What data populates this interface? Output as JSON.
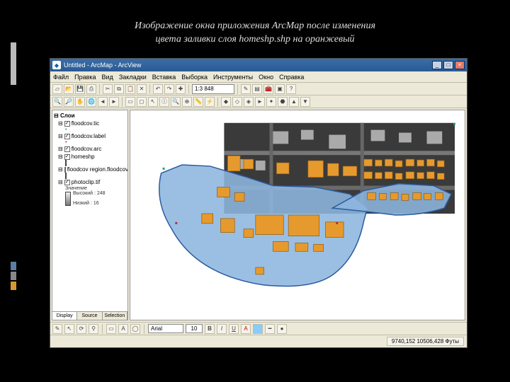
{
  "slide_caption_line1": "Изображение окна приложения ArcMap после изменения",
  "slide_caption_line2": "цвета заливки слоя homeshp.shp на оранжевый",
  "titlebar": {
    "text": "Untitled - ArcMap - ArcView"
  },
  "window_buttons": {
    "min": "_",
    "max": "□",
    "close": "×"
  },
  "menus": [
    "Файл",
    "Правка",
    "Вид",
    "Закладки",
    "Вставка",
    "Выборка",
    "Инструменты",
    "Окно",
    "Справка"
  ],
  "scale": "1:3 848",
  "toc": {
    "root": "Слои",
    "layers": [
      {
        "name": "floodcov.tic",
        "checked": true,
        "sym": "dot"
      },
      {
        "name": "floodcov.label",
        "checked": true,
        "sym": "dot2"
      },
      {
        "name": "floodcov.arc",
        "checked": true,
        "sym": "line"
      },
      {
        "name": "homeshp",
        "checked": true,
        "sym": "orange"
      },
      {
        "name": "floodcov region.floodcov",
        "checked": false,
        "sym": "blue"
      },
      {
        "name": "photoclip.tif",
        "checked": true,
        "sym": "gray"
      }
    ],
    "raster_header": "Значение",
    "raster_high": "Высокий : 248",
    "raster_low": "Низкий : 16",
    "tabs": [
      "Display",
      "Source",
      "Selection"
    ]
  },
  "bottom": {
    "font": "Arial",
    "size": "10"
  },
  "status": {
    "coords": "9740,152 10506,428 Футы"
  }
}
